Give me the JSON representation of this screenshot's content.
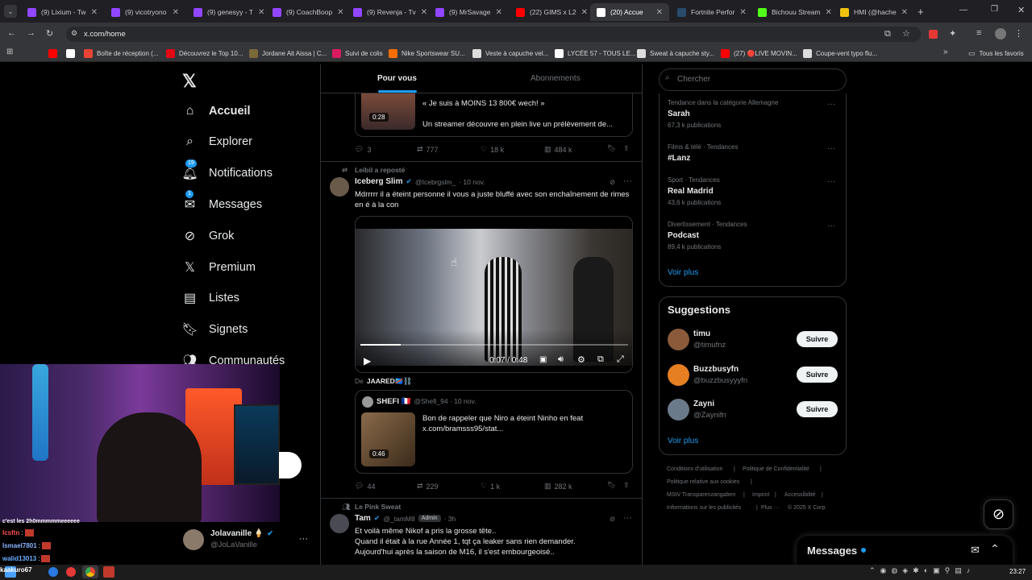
{
  "browser": {
    "tabs": [
      {
        "label": "(9) Lixium - Tw",
        "color": "#9146ff"
      },
      {
        "label": "(9) vicotryono",
        "color": "#9146ff"
      },
      {
        "label": "(9) genesyy - T",
        "color": "#9146ff"
      },
      {
        "label": "(9) CoachBoop",
        "color": "#9146ff"
      },
      {
        "label": "(9) Revenja - Tv",
        "color": "#9146ff"
      },
      {
        "label": "(9) MrSavage",
        "color": "#9146ff"
      },
      {
        "label": "(22) GIMS x L2",
        "color": "#ff0000"
      },
      {
        "label": "(20) Accue",
        "color": "#ffffff"
      },
      {
        "label": "Fortnite Perfor",
        "color": "#2a4a6a"
      },
      {
        "label": "Bichouu Stream",
        "color": "#53fc18"
      },
      {
        "label": "HMI (@hache",
        "color": "#f1c40f"
      }
    ],
    "url": "x.com/home",
    "bookmarks": [
      {
        "label": "",
        "color": "#ff0000"
      },
      {
        "label": "",
        "color": "#ffffff"
      },
      {
        "label": "Boîte de réception (...",
        "color": "#ea4335"
      },
      {
        "label": "Découvrez le Top 10...",
        "color": "#e50914"
      },
      {
        "label": "Jordane Ait Aissa | C...",
        "color": "#7a6a3a"
      },
      {
        "label": "Suivi de colis",
        "color": "#d81b60"
      },
      {
        "label": "Nike Sportswear SU...",
        "color": "#ff6f00"
      },
      {
        "label": "Veste à capuche vel...",
        "color": "#dddddd"
      },
      {
        "label": "LYCÉE 57 - TOUS LE...",
        "color": "#ffffff"
      },
      {
        "label": "Sweat à capuche sty...",
        "color": "#dddddd"
      },
      {
        "label": "(27) 🔴LIVE MOVIN...",
        "color": "#ff0000"
      },
      {
        "label": "Coupe-vent typo flu...",
        "color": "#dddddd"
      }
    ],
    "all_favorites": "Tous les favoris"
  },
  "nav": {
    "items": [
      {
        "label": "Accueil",
        "icon": "home-icon",
        "glyph": "⌂"
      },
      {
        "label": "Explorer",
        "icon": "search-icon",
        "glyph": "⌕"
      },
      {
        "label": "Notifications",
        "icon": "bell-icon",
        "glyph": "🔔︎",
        "badge": "19"
      },
      {
        "label": "Messages",
        "icon": "envelope-icon",
        "glyph": "✉",
        "badge": "1"
      },
      {
        "label": "Grok",
        "icon": "grok-icon",
        "glyph": "⊘"
      },
      {
        "label": "Premium",
        "icon": "x-logo-icon",
        "glyph": "𝕏"
      },
      {
        "label": "Listes",
        "icon": "list-icon",
        "glyph": "▤"
      },
      {
        "label": "Signets",
        "icon": "bookmark-icon",
        "glyph": "🔖︎"
      },
      {
        "label": "Communautés",
        "icon": "communities-icon",
        "glyph": "👥︎"
      }
    ],
    "account": {
      "name": "Jolavanille 🍦",
      "handle": "@JoLaVanille"
    }
  },
  "feed": {
    "tabs": [
      "Pour vous",
      "Abonnements"
    ],
    "tweet0": {
      "card_title": "« Je suis à MOINS 13 800€ wech! »",
      "card_desc": "Un streamer découvre en plein live un prélèvement de...",
      "duration": "0:28",
      "replies": "3",
      "reposts": "777",
      "likes": "18 k",
      "views": "484 k"
    },
    "tweet1": {
      "repost": "Leibil a reposté",
      "name": "Iceberg Slim",
      "handle": "@Icebrgslm_",
      "date": "· 10 nov.",
      "text": "Mdrrrrr il a éteint personne il vous a juste bluffé avec son enchaînement de rimes en é à la con",
      "video_time": "0:07 / 0:48",
      "video_progress": 0.15,
      "from": "De",
      "from_name": "JAARED🇨🇩⛓️",
      "quote_name": "SHEFI 🇫🇷",
      "quote_handle": "@Shefi_94 · 10 nov.",
      "quote_text": "Bon de rappeler que Niro a éteint Ninho en feat x.com/bramsss95/stat...",
      "quote_duration": "0:46",
      "replies": "44",
      "reposts": "229",
      "likes": "1 k",
      "views": "282 k"
    },
    "tweet2": {
      "repost": "Le Pink Sweat",
      "name": "Tam",
      "handle": "@_tamM8",
      "admin": "Admin",
      "date": "· 3h",
      "lines": [
        "Et voilà même Nikof a pris la grosse tête..",
        "Quand il était à la rue Année 1, tqt ça leaker sans rien demander.",
        "Aujourd'hui après la saison de M16, il s'est embourgeoisé.."
      ]
    }
  },
  "sidebar": {
    "search_placeholder": "Chercher",
    "trends": [
      {
        "category": "Tendance dans la catégorie Allemagne",
        "name": "Sarah",
        "count": "67,3 k publications"
      },
      {
        "category": "Films & télé · Tendances",
        "name": "#Lanz",
        "count": ""
      },
      {
        "category": "Sport · Tendances",
        "name": "Real Madrid",
        "count": "43,6 k publications"
      },
      {
        "category": "Divertissement · Tendances",
        "name": "Podcast",
        "count": "89,4 k publications"
      }
    ],
    "see_more": "Voir plus",
    "suggestions_title": "Suggestions",
    "suggestions": [
      {
        "name": "timu",
        "handle": "@timufnz",
        "color": "#8a5a3a"
      },
      {
        "name": "Buzzbusyfn",
        "handle": "@buzzbusyyyfn",
        "color": "#e67e22"
      },
      {
        "name": "Zayni",
        "handle": "@Zaynifn",
        "color": "#6a7a8a"
      }
    ],
    "follow_label": "Suivre",
    "footer": [
      "Conditions d'utilisation",
      "|",
      "Politique de Confidentialité",
      "|",
      "Politique relative aux cookies",
      "|",
      "MStV Transparenzangaben",
      "|",
      "Imprint",
      "|",
      "Accessibilité",
      "|",
      "Informations sur les publicités",
      "|",
      "Plus ···",
      "© 2025 X Corp."
    ],
    "messages_label": "Messages"
  },
  "chat": {
    "lines": [
      {
        "user": "c'est les 2h0mmmmmeeeeee",
        "msg": ""
      },
      {
        "user": "Icsftn",
        "msg": ":"
      },
      {
        "user": "Ismael7801",
        "msg": ":"
      },
      {
        "user": "walid13013",
        "msg": ":"
      },
      {
        "user": "kaakuro67",
        "msg": ""
      }
    ]
  },
  "taskbar": {
    "time": "23:27"
  }
}
